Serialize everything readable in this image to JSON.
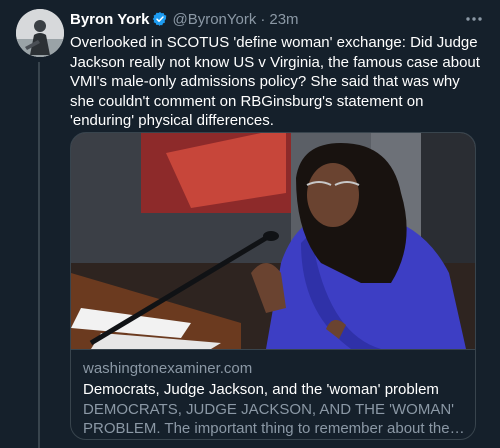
{
  "tweet": {
    "author_name": "Byron York",
    "author_handle": "@ByronYork",
    "separator": "·",
    "time": "23m",
    "text": "Overlooked in SCOTUS 'define woman' exchange: Did Judge Jackson really not know US v Virginia, the famous case about VMI's male-only admissions policy? She said that was why she couldn't comment on RBGinsburg's statement on 'enduring' physical differences.",
    "icons": {
      "verified": "verified-badge-icon",
      "more": "more-options-icon"
    },
    "colors": {
      "background": "#15202b",
      "secondary_text": "#8b98a5",
      "verified": "#1d9bf0",
      "border": "#38444d",
      "jacket": "#3d3ec4"
    }
  },
  "card": {
    "domain": "washingtonexaminer.com",
    "title": "Democrats, Judge Jackson, and the 'woman' problem",
    "description_line1": "DEMOCRATS, JUDGE JACKSON, AND THE 'WOMAN'",
    "description_line2": "PROBLEM. The important thing to remember about the now..."
  }
}
